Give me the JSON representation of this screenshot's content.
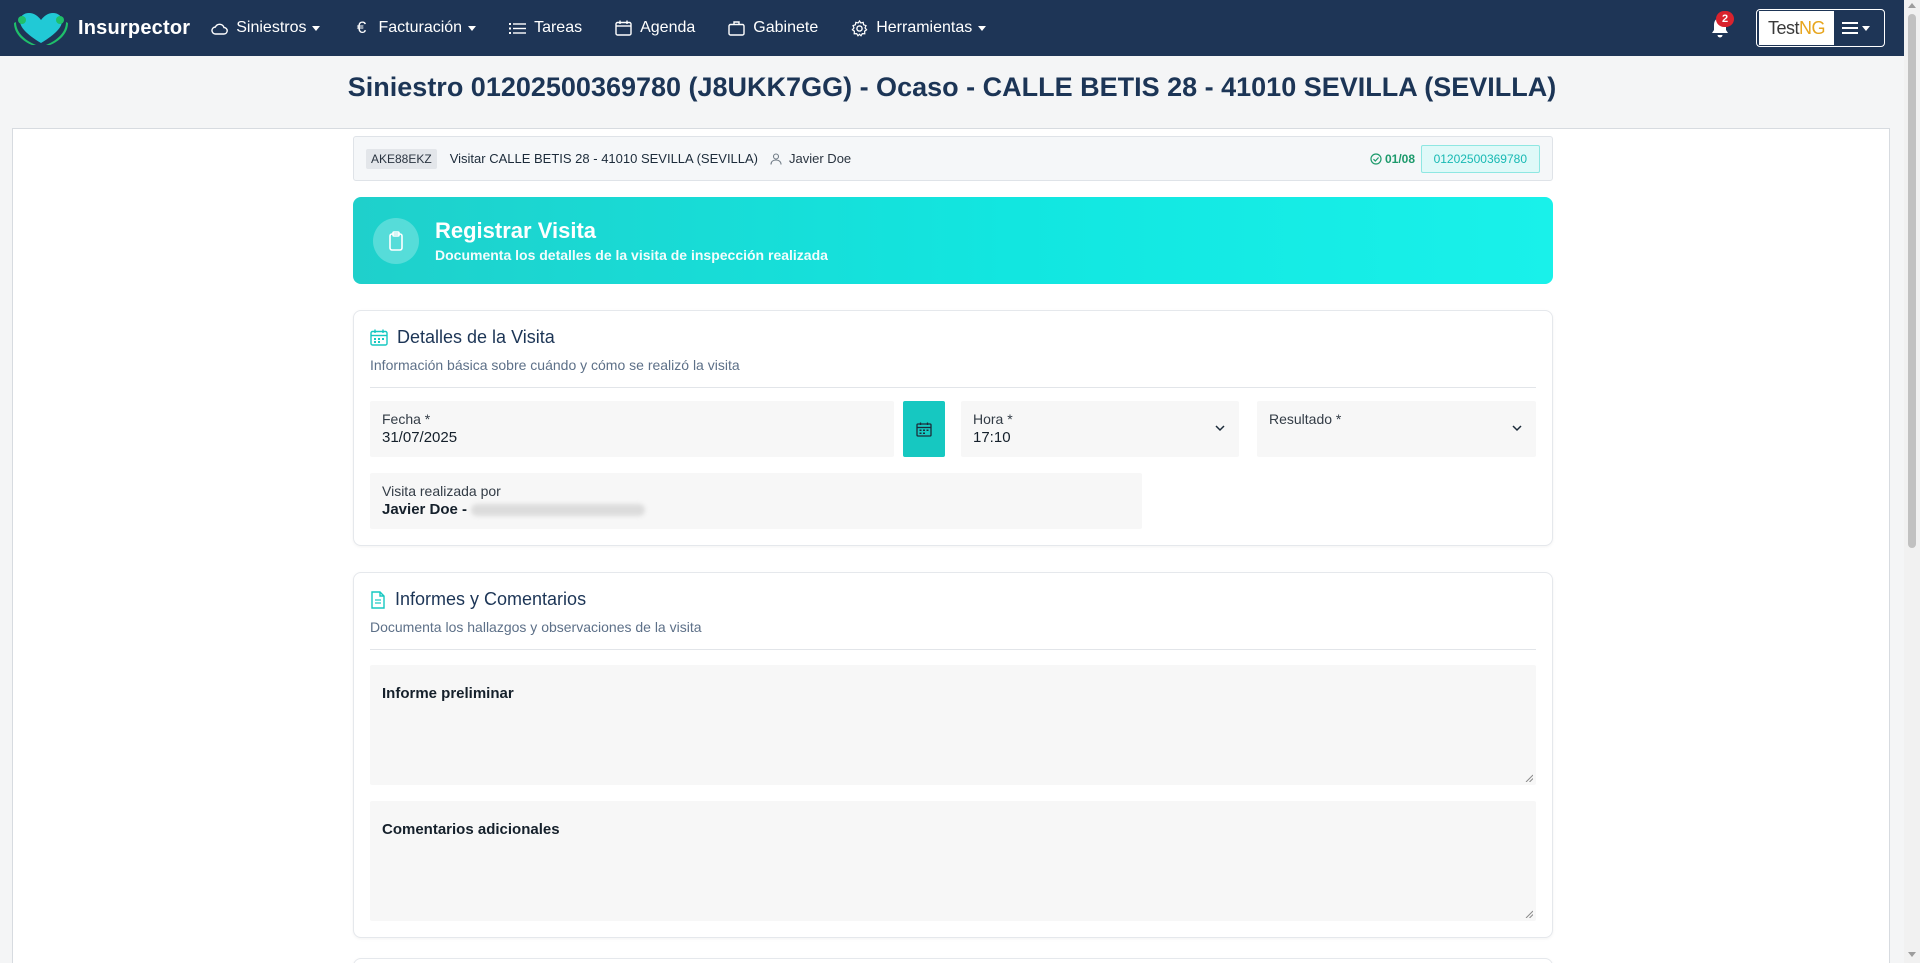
{
  "nav": {
    "brand": "Insurpector",
    "items": [
      {
        "label": "Siniestros",
        "icon": "cloud-icon",
        "dropdown": true
      },
      {
        "label": "Facturación",
        "icon": "euro-icon",
        "dropdown": true
      },
      {
        "label": "Tareas",
        "icon": "list-icon",
        "dropdown": false
      },
      {
        "label": "Agenda",
        "icon": "calendar-icon",
        "dropdown": false
      },
      {
        "label": "Gabinete",
        "icon": "briefcase-icon",
        "dropdown": false
      },
      {
        "label": "Herramientas",
        "icon": "gear-icon",
        "dropdown": true
      }
    ],
    "notifications_count": "2",
    "user_logo_text_1": "Test",
    "user_logo_text_2": "NG"
  },
  "page": {
    "title": "Siniestro 01202500369780 (J8UKK7GG) - Ocaso - CALLE BETIS 28 - 41010 SEVILLA (SEVILLA)"
  },
  "visit_bar": {
    "code": "AKE88EKZ",
    "label": "Visitar CALLE BETIS 28 - 41010 SEVILLA (SEVILLA)",
    "person": "Javier Doe",
    "count": "01/08",
    "claim_number": "01202500369780"
  },
  "hero": {
    "title": "Registrar Visita",
    "subtitle": "Documenta los detalles de la visita de inspección realizada"
  },
  "details": {
    "title": "Detalles de la Visita",
    "subtitle": "Información básica sobre cuándo y cómo se realizó la visita",
    "fecha_label": "Fecha *",
    "fecha_value": "31/07/2025",
    "hora_label": "Hora *",
    "hora_value": "17:10",
    "resultado_label": "Resultado *",
    "resultado_value": "",
    "realizada_label": "Visita realizada por",
    "realizada_value": "Javier Doe -"
  },
  "reports": {
    "title": "Informes y Comentarios",
    "subtitle": "Documenta los hallazgos y observaciones de la visita",
    "informe_label": "Informe preliminar",
    "comentarios_label": "Comentarios adicionales"
  },
  "colors": {
    "navbar": "#1e3556",
    "accent": "#16c8c1",
    "badge": "#d9232e"
  }
}
